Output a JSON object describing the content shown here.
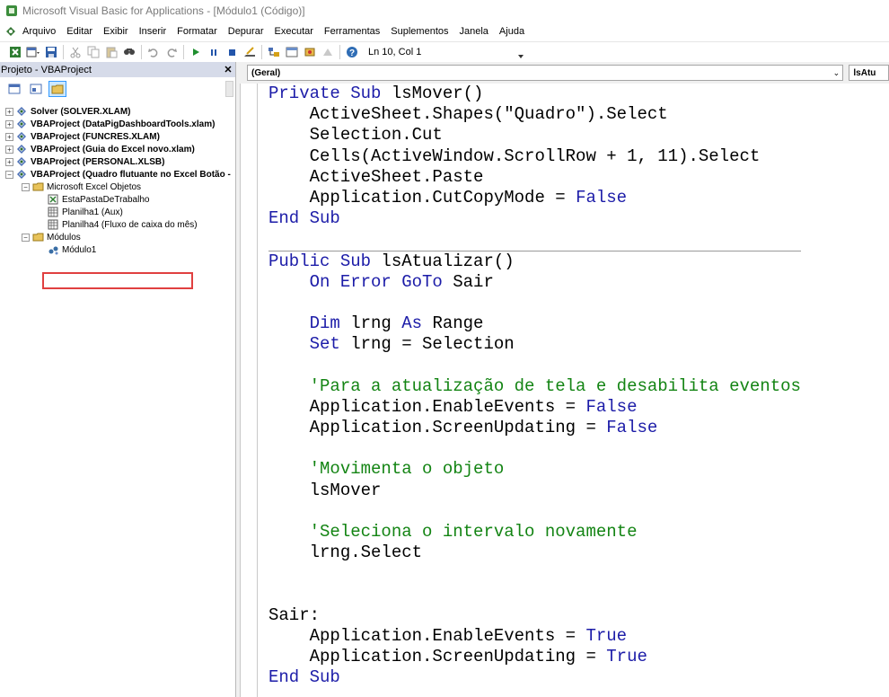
{
  "window": {
    "title": "Microsoft Visual Basic for Applications - [Módulo1 (Código)]"
  },
  "menu": {
    "items": [
      "Arquivo",
      "Editar",
      "Exibir",
      "Inserir",
      "Formatar",
      "Depurar",
      "Executar",
      "Ferramentas",
      "Suplementos",
      "Janela",
      "Ajuda"
    ]
  },
  "toolbar": {
    "status": "Ln 10, Col 1",
    "icons": [
      "view-excel-icon",
      "insert-module-icon",
      "save-icon",
      "cut-icon",
      "copy-icon",
      "paste-icon",
      "find-icon",
      "undo-icon",
      "redo-icon",
      "run-icon",
      "break-icon",
      "reset-icon",
      "design-mode-icon",
      "project-explorer-icon",
      "properties-icon",
      "object-browser-icon",
      "toolbox-icon",
      "help-icon"
    ]
  },
  "project_pane": {
    "title": "Projeto - VBAProject",
    "close": "✕",
    "tree": [
      {
        "label": "Solver (SOLVER.XLAM)",
        "level": 0,
        "expander": "+",
        "bold": true
      },
      {
        "label": "VBAProject (DataPigDashboardTools.xlam)",
        "level": 0,
        "expander": "+",
        "bold": true
      },
      {
        "label": "VBAProject (FUNCRES.XLAM)",
        "level": 0,
        "expander": "+",
        "bold": true
      },
      {
        "label": "VBAProject (Guia do Excel novo.xlam)",
        "level": 0,
        "expander": "+",
        "bold": true
      },
      {
        "label": "VBAProject (PERSONAL.XLSB)",
        "level": 0,
        "expander": "+",
        "bold": true
      },
      {
        "label": "VBAProject (Quadro flutuante no Excel Botão -",
        "level": 0,
        "expander": "−",
        "bold": true
      },
      {
        "label": "Microsoft Excel Objetos",
        "level": 1,
        "expander": "−",
        "bold": false
      },
      {
        "label": "EstaPastaDeTrabalho",
        "level": 2,
        "expander": "",
        "bold": false
      },
      {
        "label": "Planilha1 (Aux)",
        "level": 2,
        "expander": "",
        "bold": false
      },
      {
        "label": "Planilha4 (Fluxo de caixa do mês)",
        "level": 2,
        "expander": "",
        "bold": false
      },
      {
        "label": "Módulos",
        "level": 1,
        "expander": "−",
        "bold": false
      },
      {
        "label": "Módulo1",
        "level": 2,
        "expander": "",
        "bold": false
      }
    ]
  },
  "code_window": {
    "object_combo": "(Geral)",
    "procedure_combo": "lsAtu",
    "lines": [
      [
        {
          "t": "Private Sub ",
          "c": "kw"
        },
        {
          "t": "lsMover()",
          "c": "tx"
        }
      ],
      [
        {
          "t": "    ActiveSheet.Shapes(\"Quadro\").Select",
          "c": "tx"
        }
      ],
      [
        {
          "t": "    Selection.Cut",
          "c": "tx"
        }
      ],
      [
        {
          "t": "    Cells(ActiveWindow.ScrollRow + 1, 11).Select",
          "c": "tx"
        }
      ],
      [
        {
          "t": "    ActiveSheet.Paste",
          "c": "tx"
        }
      ],
      [
        {
          "t": "    Application.CutCopyMode = ",
          "c": "tx"
        },
        {
          "t": "False",
          "c": "kw"
        }
      ],
      [
        {
          "t": "End Sub",
          "c": "kw"
        }
      ],
      [],
      [
        {
          "t": "Public Sub ",
          "c": "kw"
        },
        {
          "t": "lsAtualizar()",
          "c": "tx"
        }
      ],
      [
        {
          "t": "    On Error GoTo ",
          "c": "kw"
        },
        {
          "t": "Sair",
          "c": "tx"
        }
      ],
      [],
      [
        {
          "t": "    Dim ",
          "c": "kw"
        },
        {
          "t": "lrng ",
          "c": "tx"
        },
        {
          "t": "As ",
          "c": "kw"
        },
        {
          "t": "Range",
          "c": "tx"
        }
      ],
      [
        {
          "t": "    Set ",
          "c": "kw"
        },
        {
          "t": "lrng = Selection",
          "c": "tx"
        }
      ],
      [],
      [
        {
          "t": "    'Para a atualização de tela e desabilita eventos",
          "c": "cm"
        }
      ],
      [
        {
          "t": "    Application.EnableEvents = ",
          "c": "tx"
        },
        {
          "t": "False",
          "c": "kw"
        }
      ],
      [
        {
          "t": "    Application.ScreenUpdating = ",
          "c": "tx"
        },
        {
          "t": "False",
          "c": "kw"
        }
      ],
      [],
      [
        {
          "t": "    'Movimenta o objeto",
          "c": "cm"
        }
      ],
      [
        {
          "t": "    lsMover",
          "c": "tx"
        }
      ],
      [],
      [
        {
          "t": "    'Seleciona o intervalo novamente",
          "c": "cm"
        }
      ],
      [
        {
          "t": "    lrng.Select",
          "c": "tx"
        }
      ],
      [],
      [],
      [
        {
          "t": "Sair:",
          "c": "tx"
        }
      ],
      [
        {
          "t": "    Application.EnableEvents = ",
          "c": "tx"
        },
        {
          "t": "True",
          "c": "kw"
        }
      ],
      [
        {
          "t": "    Application.ScreenUpdating = ",
          "c": "tx"
        },
        {
          "t": "True",
          "c": "kw"
        }
      ],
      [
        {
          "t": "End Sub",
          "c": "kw"
        }
      ]
    ]
  },
  "colors": {
    "keyword": "#1c1ca8",
    "comment": "#138413",
    "selection_outline": "#e04040",
    "pane_title_bg": "#d6dbe9"
  }
}
